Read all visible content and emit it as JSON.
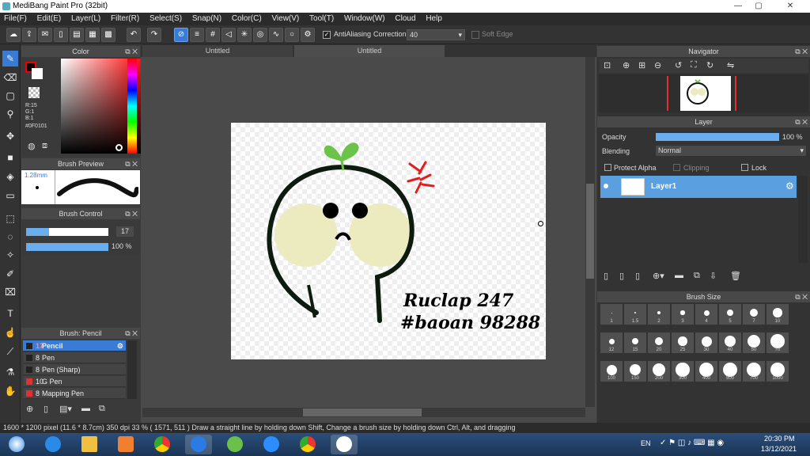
{
  "window": {
    "title": "MediBang Paint Pro (32bit)",
    "min": "—",
    "max": "▢",
    "close": "✕"
  },
  "menu": [
    "File(F)",
    "Edit(E)",
    "Layer(L)",
    "Filter(R)",
    "Select(S)",
    "Snap(N)",
    "Color(C)",
    "View(V)",
    "Tool(T)",
    "Window(W)",
    "Cloud",
    "Help"
  ],
  "toolbar": {
    "antialias_label": "AntiAliasing",
    "correction_label": "Correction",
    "correction_value": "40",
    "soft_edge_label": "Soft Edge"
  },
  "color_panel": {
    "title": "Color",
    "r": "R:15",
    "g": "G:1",
    "b": "B:1",
    "hex": "#0F0101"
  },
  "brush_preview": {
    "title": "Brush Preview",
    "size": "1.28mm"
  },
  "brush_control": {
    "title": "Brush Control",
    "size": "17",
    "opacity": "100 %",
    "size_fraction": 0.28,
    "opacity_fraction": 1.0
  },
  "brush_list": {
    "title": "Brush: Pencil",
    "items": [
      {
        "num": "17",
        "name": "Pencil",
        "color": "#222222"
      },
      {
        "num": "8",
        "name": "Pen",
        "color": "#222222"
      },
      {
        "num": "8",
        "name": "Pen (Sharp)",
        "color": "#222222"
      },
      {
        "num": "10",
        "name": "G Pen",
        "color": "#e03030"
      },
      {
        "num": "8",
        "name": "Mapping Pen",
        "color": "#e03030"
      }
    ]
  },
  "tabs": [
    "Untitled",
    "Untitled"
  ],
  "canvas_text": {
    "line1": "Ruclap 247",
    "line2": "#baoan 98288"
  },
  "navigator": {
    "title": "Navigator"
  },
  "layer_panel": {
    "title": "Layer",
    "opacity_label": "Opacity",
    "opacity_value": "100 %",
    "blending_label": "Blending",
    "blending_value": "Normal",
    "protect_alpha": "Protect Alpha",
    "clipping": "Clipping",
    "lock": "Lock",
    "layer_name": "Layer1"
  },
  "brush_size": {
    "title": "Brush Size",
    "sizes": [
      "1",
      "1.5",
      "2",
      "3",
      "4",
      "5",
      "7",
      "10",
      "12",
      "15",
      "20",
      "25",
      "30",
      "40",
      "50",
      "70",
      "100",
      "150",
      "200",
      "300",
      "400",
      "500",
      "700",
      "1000"
    ]
  },
  "status": {
    "text": "1600 * 1200 pixel  (11.6 * 8.7cm)  350 dpi  33 %  ( 1571, 511 )  Draw a straight line by holding down Shift, Change a brush size by holding down Ctrl, Alt, and dragging"
  },
  "taskbar": {
    "lang": "EN",
    "time": "20:30 PM",
    "date": "13/12/2021"
  }
}
